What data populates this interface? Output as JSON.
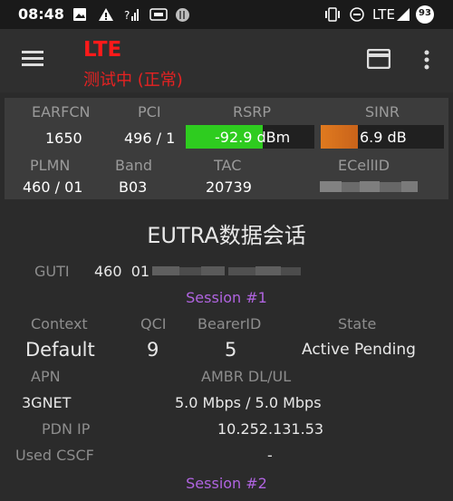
{
  "status_bar": {
    "time": "08:48",
    "network": "LTE",
    "battery_level": "93",
    "icons": [
      "image-icon",
      "alert-icon",
      "signal-question-icon",
      "data-icon",
      "circle-app-icon",
      "vibrate-icon",
      "dnd-icon",
      "signal-icon",
      "battery-icon"
    ]
  },
  "app_bar": {
    "title": "LTE",
    "subtitle": "测试中 (正常)",
    "title_color": "#ff1a1a"
  },
  "cell_info": {
    "earfcn_label": "EARFCN",
    "earfcn": "1650",
    "pci_label": "PCI",
    "pci": "496 / 1",
    "rsrp_label": "RSRP",
    "rsrp": "-92.9 dBm",
    "rsrp_level": 0.6,
    "sinr_label": "SINR",
    "sinr": "6.9 dB",
    "sinr_level": 0.3,
    "plmn_label": "PLMN",
    "plmn": "460 / 01",
    "band_label": "Band",
    "band": "B03",
    "tac_label": "TAC",
    "tac": "20739",
    "ecellid_label": "ECellID",
    "rsrp_color": "#2ecc1f",
    "sinr_color": "#e07a1f"
  },
  "session_section": {
    "heading": "EUTRA数据会话",
    "guti_label": "GUTI",
    "guti_value": "460  01",
    "session1_title": "Session #1",
    "context_label": "Context",
    "context": "Default",
    "qci_label": "QCI",
    "qci": "9",
    "bearer_label": "BearerID",
    "bearer": "5",
    "state_label": "State",
    "state": "Active Pending",
    "apn_label": "APN",
    "apn": "3GNET",
    "ambr_label": "AMBR DL/UL",
    "ambr": "5.0 Mbps / 5.0 Mbps",
    "pdn_label": "PDN IP",
    "pdn": "10.252.131.53",
    "cscf_label": "Used CSCF",
    "cscf": "-",
    "session2_title": "Session #2",
    "accent_color": "#b064e0"
  }
}
